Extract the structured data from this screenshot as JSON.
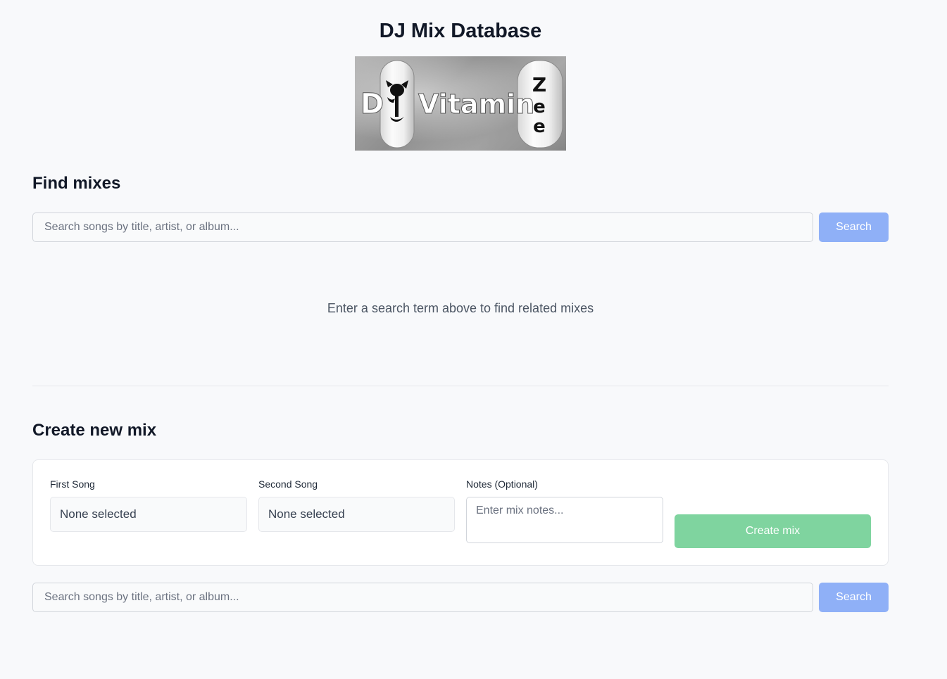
{
  "header": {
    "title": "DJ Mix Database",
    "logo": {
      "letter_left": "D",
      "word": "Vitamin",
      "letters_right": [
        "Z",
        "e",
        "e"
      ]
    }
  },
  "find": {
    "heading": "Find mixes",
    "search": {
      "placeholder": "Search songs by title, artist, or album...",
      "value": "",
      "button_label": "Search"
    },
    "empty_message": "Enter a search term above to find related mixes"
  },
  "create": {
    "heading": "Create new mix",
    "first_song": {
      "label": "First Song",
      "value": "None selected"
    },
    "second_song": {
      "label": "Second Song",
      "value": "None selected"
    },
    "notes": {
      "label": "Notes (Optional)",
      "placeholder": "Enter mix notes...",
      "value": ""
    },
    "create_button_label": "Create mix",
    "search": {
      "placeholder": "Search songs by title, artist, or album...",
      "value": "",
      "button_label": "Search"
    }
  },
  "colors": {
    "search_button": "#8fb0f7",
    "create_button": "#7fd49f",
    "background": "#f8f9fb"
  }
}
